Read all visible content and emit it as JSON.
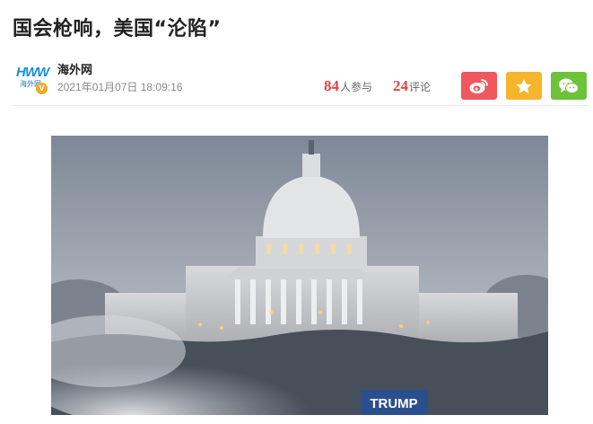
{
  "article": {
    "title": "国会枪响，美国“沦陷”"
  },
  "source": {
    "logo_text": "HWW",
    "logo_sub": "海外网",
    "verified_mark": "V",
    "name": "海外网",
    "time": "2021年01月07日 18:09:16"
  },
  "stats": {
    "participants_count": "84",
    "participants_label": "人参与",
    "comments_count": "24",
    "comments_label": "评论"
  },
  "share": {
    "weibo_icon": "weibo-icon",
    "favorite_icon": "star-icon",
    "wechat_icon": "wechat-icon",
    "weibo_color": "#f0575f",
    "favorite_color": "#f7b52c",
    "wechat_color": "#6cc33a"
  },
  "photo": {
    "banner_text": "TRUMP"
  }
}
